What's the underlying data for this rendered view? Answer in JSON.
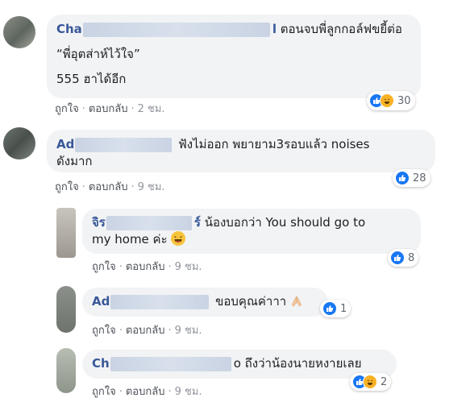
{
  "comments": [
    {
      "name_prefix": "Cha",
      "name_suffix": "l",
      "text_line1": "ตอนจบพี่ลูกกอล์ฟขยี้ต่อ",
      "text_line2": "“พี่อุตส่าห์ไว้ใจ”",
      "text_line3": "555 ฮาได้อีก",
      "like_label": "ถูกใจ",
      "reply_label": "ตอบกลับ",
      "time": "2 ชม.",
      "reaction_count": "30"
    },
    {
      "name_prefix": "Ad",
      "text_line1": "ฟังไม่ออก พยายาม3รอบแล้ว noises",
      "text_line2": "ดังมาก",
      "like_label": "ถูกใจ",
      "reply_label": "ตอบกลับ",
      "time": "9 ชม.",
      "reaction_count": "28"
    }
  ],
  "replies": [
    {
      "name_prefix": "จิร",
      "name_suffix": "ร์",
      "text_line1": "น้องบอกว่า You should go to",
      "text_line2": "my home ค่ะ",
      "like_label": "ถูกใจ",
      "reply_label": "ตอบกลับ",
      "time": "9 ชม.",
      "reaction_count": "8"
    },
    {
      "name_prefix": "Ad",
      "text_line1": "ขอบคุณค่าาา",
      "like_label": "ถูกใจ",
      "reply_label": "ตอบกลับ",
      "time": "9 ชม.",
      "reaction_count": "1"
    },
    {
      "name_prefix": "Ch",
      "name_suffix": "o",
      "text_line1": "ถึงว่าน้องนายหงายเลย",
      "like_label": "ถูกใจ",
      "reply_label": "ตอบกลับ",
      "time": "9 ชม.",
      "reaction_count": "2"
    }
  ],
  "colors": {
    "bubble": "#f2f3f5",
    "name": "#385898",
    "like": "#1877f2",
    "haha": "#f7b125",
    "meta": "#90949c"
  },
  "icons": [
    "like-reaction-icon",
    "haha-reaction-icon",
    "pray-emoji-icon",
    "laughing-emoji-icon"
  ]
}
